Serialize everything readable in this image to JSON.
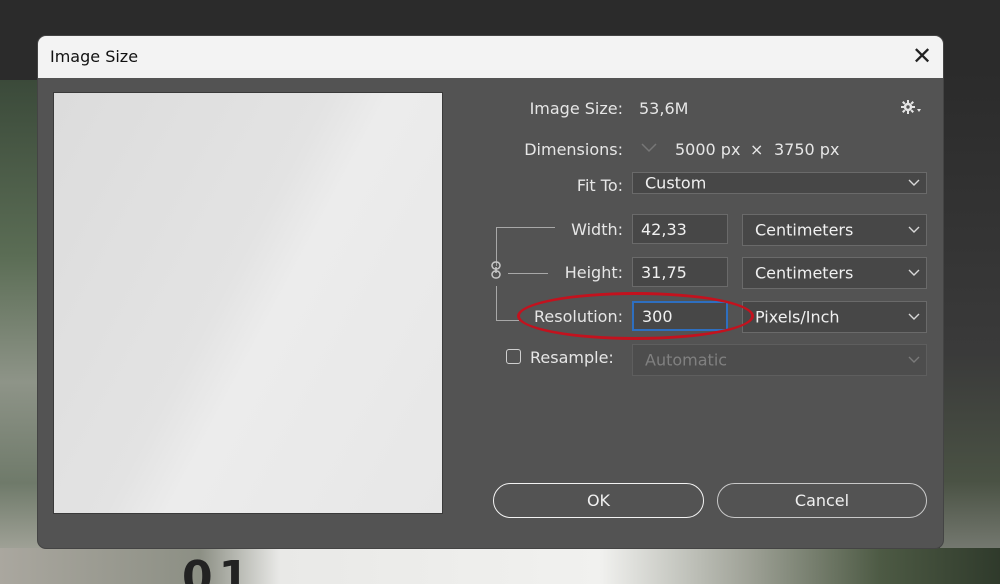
{
  "dialog": {
    "title": "Image Size",
    "close_glyph": "✕"
  },
  "info": {
    "image_size_label": "Image Size:",
    "image_size_value": "53,6M",
    "dimensions_label": "Dimensions:",
    "dimensions_width": "5000 px",
    "dimensions_times": "×",
    "dimensions_height": "3750 px"
  },
  "fit_to": {
    "label": "Fit To:",
    "value": "Custom"
  },
  "width": {
    "label": "Width:",
    "value": "42,33",
    "unit": "Centimeters"
  },
  "height": {
    "label": "Height:",
    "value": "31,75",
    "unit": "Centimeters"
  },
  "resolution": {
    "label": "Resolution:",
    "value": "300",
    "unit": "Pixels/Inch"
  },
  "resample": {
    "label": "Resample:",
    "checked": false,
    "method": "Automatic"
  },
  "buttons": {
    "ok": "OK",
    "cancel": "Cancel"
  },
  "icons": {
    "gear": "gear-icon",
    "chevron": "chevron-down-icon",
    "link": "link-icon"
  },
  "background": {
    "partial_text": "01"
  }
}
